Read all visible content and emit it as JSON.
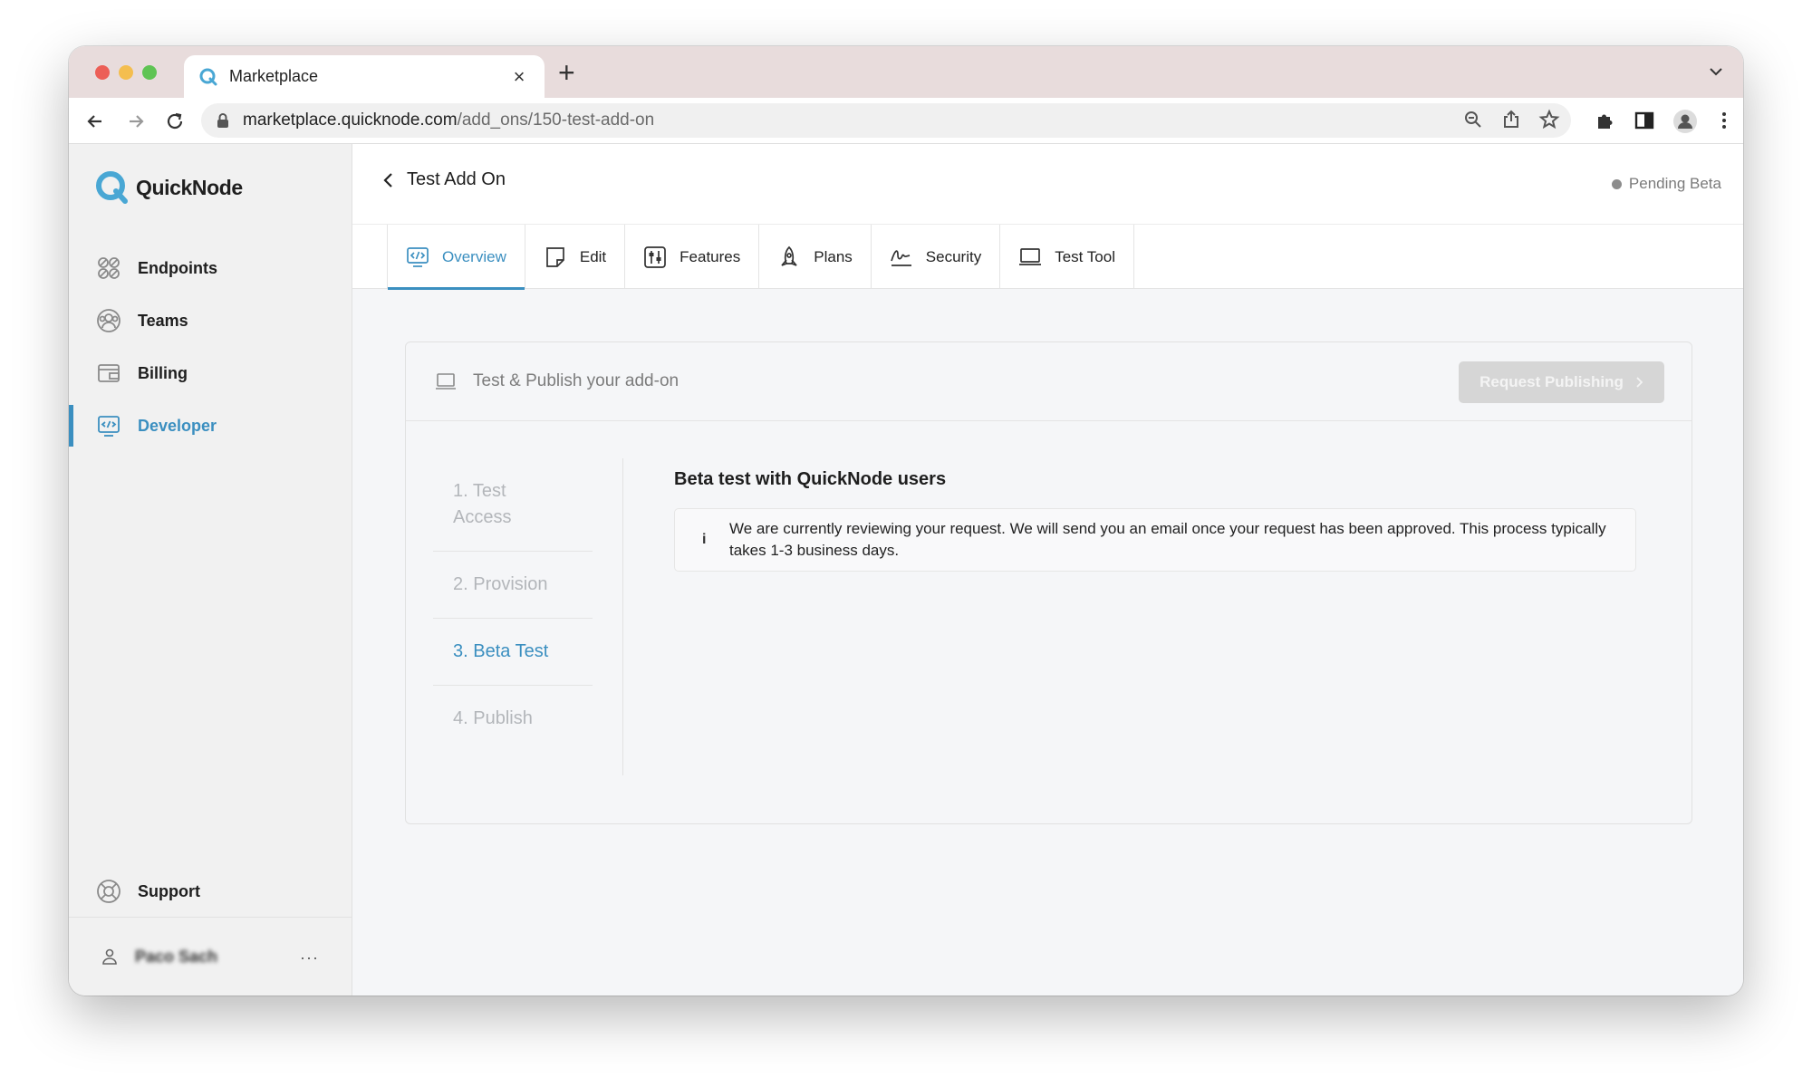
{
  "browser": {
    "tab_title": "Marketplace",
    "url_host": "marketplace.quicknode.com",
    "url_path": "/add_ons/150-test-add-on"
  },
  "sidebar": {
    "brand": "QuickNode",
    "items": [
      {
        "label": "Endpoints",
        "icon": "endpoints-icon"
      },
      {
        "label": "Teams",
        "icon": "teams-icon"
      },
      {
        "label": "Billing",
        "icon": "billing-icon"
      },
      {
        "label": "Developer",
        "icon": "developer-icon",
        "active": true
      }
    ],
    "support_label": "Support",
    "user_name": "Paco Sach",
    "more_label": "···"
  },
  "header": {
    "title": "Test Add On",
    "status": "Pending Beta"
  },
  "tabs": [
    {
      "label": "Overview",
      "icon": "code-monitor-icon",
      "active": true
    },
    {
      "label": "Edit",
      "icon": "note-icon"
    },
    {
      "label": "Features",
      "icon": "sliders-icon"
    },
    {
      "label": "Plans",
      "icon": "rocket-icon"
    },
    {
      "label": "Security",
      "icon": "signature-icon"
    },
    {
      "label": "Test Tool",
      "icon": "laptop-icon"
    }
  ],
  "card": {
    "title": "Test & Publish your add-on",
    "publish_button": "Request Publishing",
    "steps": [
      {
        "label": "1. Test Access"
      },
      {
        "label": "2. Provision"
      },
      {
        "label": "3. Beta Test",
        "active": true
      },
      {
        "label": "4. Publish"
      }
    ],
    "section_title": "Beta test with QuickNode users",
    "notice_icon": "i",
    "notice_text": "We are currently reviewing your request. We will send you an email once your request has been approved. This process typically takes 1-3 business days."
  },
  "colors": {
    "accent": "#3b8fc0",
    "sidebar_bg": "#f1f1f1",
    "main_bg": "#f5f6f8",
    "disabled_button": "#d6d6d6"
  }
}
